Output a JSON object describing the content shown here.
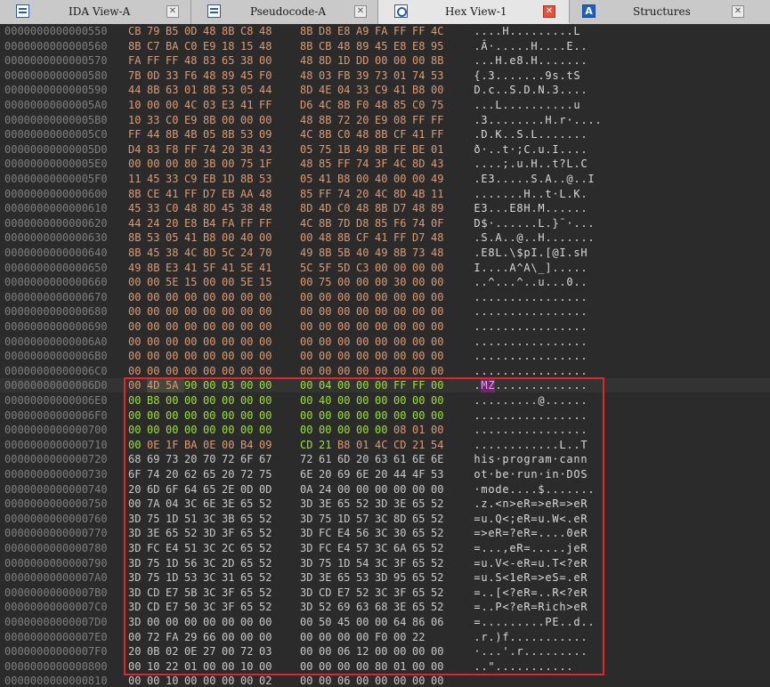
{
  "tabs": [
    {
      "label": "IDA View-A",
      "icon": "ida-view-icon",
      "close": "✕",
      "active": false
    },
    {
      "label": "Pseudocode-A",
      "icon": "pseudocode-icon",
      "close": "✕",
      "active": false
    },
    {
      "label": "Hex View-1",
      "icon": "hex-view-icon",
      "close": "✕",
      "active": true
    },
    {
      "label": "Structures",
      "icon": "structures-icon",
      "close": "✕",
      "active": false
    }
  ],
  "colors": {
    "address": "#7f7f7f",
    "hex": "#dd9a72",
    "header_hex": "#c8c8c8",
    "green": "#9be22d",
    "ascii": "#d9d9d9",
    "selection_border": "#e0252b"
  },
  "rows": [
    {
      "addr": "0000000000000550",
      "hex": "CB 79 B5 0D 48 8B C8 48 8B D8 E8 A9 FA FF FF 4C",
      "ascii": "....H.........L"
    },
    {
      "addr": "0000000000000560",
      "hex": "8B C7 BA C0 E9 18 15 48 8B CB 48 89 45 E8 E8 95",
      "ascii": ".Â·.....H....E.."
    },
    {
      "addr": "0000000000000570",
      "hex": "FA FF FF 48 83 65 38 00 48 8D 1D DD 00 00 00 8B",
      "ascii": "...H.e8.H......."
    },
    {
      "addr": "0000000000000580",
      "hex": "7B 0D 33 F6 48 89 45 F0 48 03 FB 39 73 01 74 53",
      "ascii": "{.3.......9s.tS"
    },
    {
      "addr": "0000000000000590",
      "hex": "44 8B 63 01 8B 53 05 44 8D 4E 04 33 C9 41 B8 00",
      "ascii": "D.c..S.D.N.3...."
    },
    {
      "addr": "00000000000005A0",
      "hex": "10 00 00 4C 03 E3 41 FF D6 4C 8B F0 48 85 C0 75",
      "ascii": "...L..........u"
    },
    {
      "addr": "00000000000005B0",
      "hex": "10 33 C0 E9 8B 00 00 00 48 8B 72 20 E9 08 FF FF",
      "ascii": ".3........H.r·...."
    },
    {
      "addr": "00000000000005C0",
      "hex": "FF 44 8B 4B 05 8B 53 09 4C 8B C0 48 8B CF 41 FF",
      "ascii": ".D.K..S.L......."
    },
    {
      "addr": "00000000000005D0",
      "hex": "D4 83 F8 FF 74 20 3B 43 05 75 1B 49 8B FE BE 01",
      "ascii": "ð·..t·;C.u.I...."
    },
    {
      "addr": "00000000000005E0",
      "hex": "00 00 00 80 3B 00 75 1F 48 85 FF 74 3F 4C 8D 43",
      "ascii": "....;.u.H..t?L.C"
    },
    {
      "addr": "00000000000005F0",
      "hex": "11 45 33 C9 EB 1D 8B 53 05 41 B8 00 40 00 00 49",
      "ascii": ".E3.....S.A..@..I"
    },
    {
      "addr": "0000000000000600",
      "hex": "8B CE 41 FF D7 EB AA 48 85 FF 74 20 4C 8D 4B 11",
      "ascii": ".......H..t·L.K."
    },
    {
      "addr": "0000000000000610",
      "hex": "45 33 C0 48 8D 45 38 48 8D 4D C0 48 8B D7 48 89",
      "ascii": "E3...E8H.M......"
    },
    {
      "addr": "0000000000000620",
      "hex": "44 24 20 E8 B4 FA FF FF 4C 8B 7D D8 85 F6 74 0F",
      "ascii": "D$·......L.}¯·..."
    },
    {
      "addr": "0000000000000630",
      "hex": "8B 53 05 41 B8 00 40 00 00 48 8B CF 41 FF D7 48",
      "ascii": ".S.A..@..H......."
    },
    {
      "addr": "0000000000000640",
      "hex": "8B 45 38 4C 8D 5C 24 70 49 8B 5B 40 49 8B 73 48",
      "ascii": ".E8L.\\$pI.[@I.sH"
    },
    {
      "addr": "0000000000000650",
      "hex": "49 8B E3 41 5F 41 5E 41 5C 5F 5D C3 00 00 00 00",
      "ascii": "I....A^A\\_]....."
    },
    {
      "addr": "0000000000000660",
      "hex": "00 00 5E 15 00 00 5E 15 00 75 00 00 00 30 00 00",
      "ascii": "..^...^..u...0.."
    },
    {
      "addr": "0000000000000670",
      "hex": "00 00 00 00 00 00 00 00 00 00 00 00 00 00 00 00",
      "ascii": "................"
    },
    {
      "addr": "0000000000000680",
      "hex": "00 00 00 00 00 00 00 00 00 00 00 00 00 00 00 00",
      "ascii": "................"
    },
    {
      "addr": "0000000000000690",
      "hex": "00 00 00 00 00 00 00 00 00 00 00 00 00 00 00 00",
      "ascii": "................"
    },
    {
      "addr": "00000000000006A0",
      "hex": "00 00 00 00 00 00 00 00 00 00 00 00 00 00 00 00",
      "ascii": "................"
    },
    {
      "addr": "00000000000006B0",
      "hex": "00 00 00 00 00 00 00 00 00 00 00 00 00 00 00 00",
      "ascii": "................"
    },
    {
      "addr": "00000000000006C0",
      "hex": "00 00 00 00 00 00 00 00 00 00 00 00 00 00 00 00",
      "ascii": "................"
    },
    {
      "addr": "00000000000006D0",
      "hex": "00 4D 5A 90 00 03 00 00 00 04 00 00 00 FF FF 00",
      "ascii": ".MZ.............",
      "hl": true,
      "sel": [
        1,
        2
      ],
      "mz": [
        1,
        2
      ],
      "green": [
        3,
        4,
        5,
        6,
        7,
        8,
        9,
        10,
        11,
        12,
        13,
        14,
        15
      ]
    },
    {
      "addr": "00000000000006E0",
      "hex": "00 B8 00 00 00 00 00 00 00 40 00 00 00 00 00 00",
      "ascii": ".........@......",
      "green": "all"
    },
    {
      "addr": "00000000000006F0",
      "hex": "00 00 00 00 00 00 00 00 00 00 00 00 00 00 00 00",
      "ascii": "................",
      "green": "all"
    },
    {
      "addr": "0000000000000700",
      "hex": "00 00 00 00 00 00 00 00 00 00 00 00 00 08 01 00",
      "ascii": "................",
      "green": [
        0,
        1,
        2,
        3,
        4,
        5,
        6,
        7,
        8,
        9,
        10,
        11,
        12
      ]
    },
    {
      "addr": "0000000000000710",
      "hex": "00 0E 1F BA 0E 00 B4 09 CD 21 B8 01 4C CD 21 54",
      "ascii": "............L..T",
      "green": [
        0,
        8,
        9
      ]
    },
    {
      "addr": "0000000000000720",
      "hex": "68 69 73 20 70 72 6F 67 72 61 6D 20 63 61 6E 6E",
      "ascii": "his·program·cann",
      "hdr": true
    },
    {
      "addr": "0000000000000730",
      "hex": "6F 74 20 62 65 20 72 75 6E 20 69 6E 20 44 4F 53",
      "ascii": "ot·be·run·in·DOS",
      "hdr": true
    },
    {
      "addr": "0000000000000740",
      "hex": "20 6D 6F 64 65 2E 0D 0D 0A 24 00 00 00 00 00 00",
      "ascii": "·mode....$.......",
      "hdr": true
    },
    {
      "addr": "0000000000000750",
      "hex": "00 7A 04 3C 6E 3E 65 52 3D 3E 65 52 3D 3E 65 52",
      "ascii": ".z.<n>eR=>eR=>eR",
      "hdr": true
    },
    {
      "addr": "0000000000000760",
      "hex": "3D 75 1D 51 3C 3B 65 52 3D 75 1D 57 3C 8D 65 52",
      "ascii": "=u.Q<;eR=u.W<.eR",
      "hdr": true
    },
    {
      "addr": "0000000000000770",
      "hex": "3D 3E 65 52 3D 3F 65 52 3D FC E4 56 3C 30 65 52",
      "ascii": "=>eR=?eR=....0eR",
      "hdr": true
    },
    {
      "addr": "0000000000000780",
      "hex": "3D FC E4 51 3C 2C 65 52 3D FC E4 57 3C 6A 65 52",
      "ascii": "=...,eR=.....jeR",
      "hdr": true
    },
    {
      "addr": "0000000000000790",
      "hex": "3D 75 1D 56 3C 2D 65 52 3D 75 1D 54 3C 3F 65 52",
      "ascii": "=u.V<-eR=u.T<?eR",
      "hdr": true
    },
    {
      "addr": "00000000000007A0",
      "hex": "3D 75 1D 53 3C 31 65 52 3D 3E 65 53 3D 95 65 52",
      "ascii": "=u.S<1eR=>eS=.eR",
      "hdr": true
    },
    {
      "addr": "00000000000007B0",
      "hex": "3D CD E7 5B 3C 3F 65 52 3D CD E7 52 3C 3F 65 52",
      "ascii": "=..[<?eR=..R<?eR",
      "hdr": true
    },
    {
      "addr": "00000000000007C0",
      "hex": "3D CD E7 50 3C 3F 65 52 3D 52 69 63 68 3E 65 52",
      "ascii": "=..P<?eR=Rich>eR",
      "hdr": true
    },
    {
      "addr": "00000000000007D0",
      "hex": "3D 00 00 00 00 00 00 00 00 50 45 00 00 64 86 06",
      "ascii": "=.........PE..d..",
      "hdr": true
    },
    {
      "addr": "00000000000007E0",
      "hex": "00 72 FA 29 66 00 00 00 00 00 00 00 F0 00 22",
      "ascii": ".r.)f...........",
      "hdr": true
    },
    {
      "addr": "00000000000007F0",
      "hex": "20 0B 02 0E 27 00 72 03 00 00 06 12 00 00 00 00",
      "ascii": "·...'.r.........",
      "hdr": true
    },
    {
      "addr": "0000000000000800",
      "hex": "00 10 22 01 00 00 10 00 00 00 00 00 80 01 00 00",
      "ascii": "..\"...........",
      "hdr": true
    },
    {
      "addr": "0000000000000810",
      "hex": "00 00 10 00 00 00 00 02 00 00 06 00 00 00 00 00",
      "ascii": "",
      "hdr": true
    }
  ]
}
